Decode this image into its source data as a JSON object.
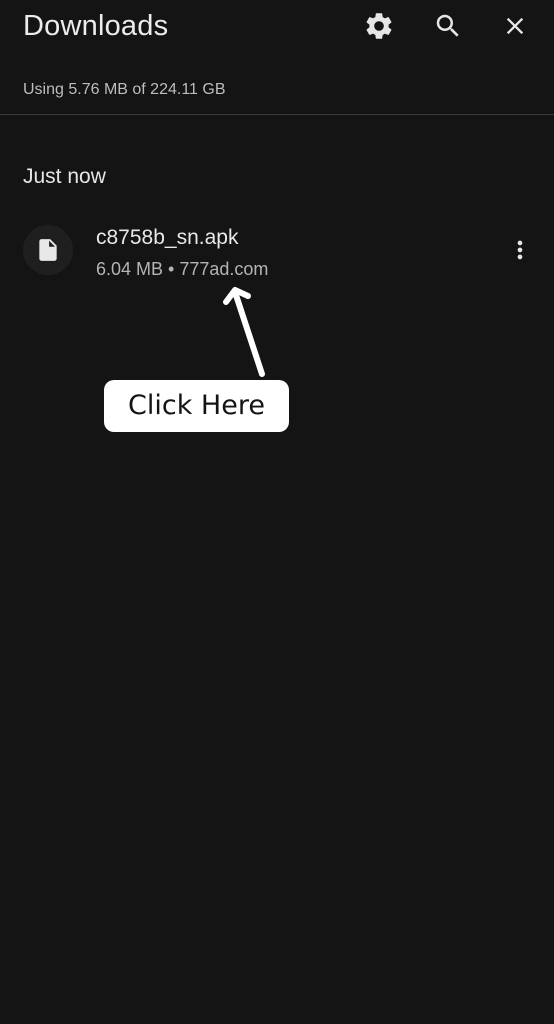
{
  "header": {
    "title": "Downloads",
    "actions": [
      {
        "icon": "gear-icon",
        "label": "Settings"
      },
      {
        "icon": "search-icon",
        "label": "Search"
      },
      {
        "icon": "close-icon",
        "label": "Close"
      }
    ]
  },
  "storage": {
    "text": "Using 5.76 MB of 224.11 GB"
  },
  "sections": [
    {
      "header": "Just now",
      "items": [
        {
          "icon": "file-icon",
          "name": "c8758b_sn.apk",
          "meta": "6.04 MB • 777ad.com",
          "menu_icon": "more-vert-icon"
        }
      ]
    }
  ],
  "annotation": {
    "text": "Click Here",
    "arrow_icon": "arrow-up-icon"
  },
  "colors": {
    "background": "#141414",
    "text_primary": "#e8e8e8",
    "text_secondary": "#b4b4b4",
    "divider": "#3a3a3a",
    "callout_bg": "#ffffff"
  }
}
